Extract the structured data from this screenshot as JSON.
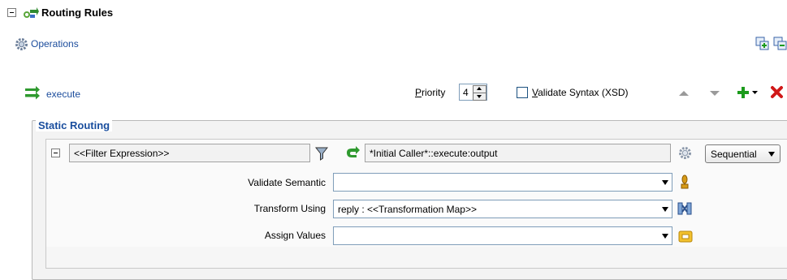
{
  "header": {
    "title": "Routing Rules",
    "collapse_symbol": "−"
  },
  "operations": {
    "label": "Operations"
  },
  "route": {
    "name": "execute"
  },
  "toolbar": {
    "priority_label_first": "P",
    "priority_label_rest": "riority",
    "priority_value": "4",
    "validate_syntax_first": "V",
    "validate_syntax_rest": "alidate Syntax (XSD)"
  },
  "static_routing": {
    "legend": "Static Routing",
    "collapse_symbol": "−",
    "filter_expression": "<<Filter Expression>>",
    "target": "*Initial Caller*::execute:output",
    "execution_mode": "Sequential",
    "validate_semantic": {
      "label": "Validate Semantic",
      "value": ""
    },
    "transform_using": {
      "label": "Transform Using",
      "value": "reply : <<Transformation Map>>"
    },
    "assign_values": {
      "label": "Assign Values",
      "value": ""
    }
  },
  "colors": {
    "link": "#1b4c9c",
    "legend": "#1a4e9e",
    "add_green": "#1c9b1c",
    "delete_red": "#d01818"
  }
}
